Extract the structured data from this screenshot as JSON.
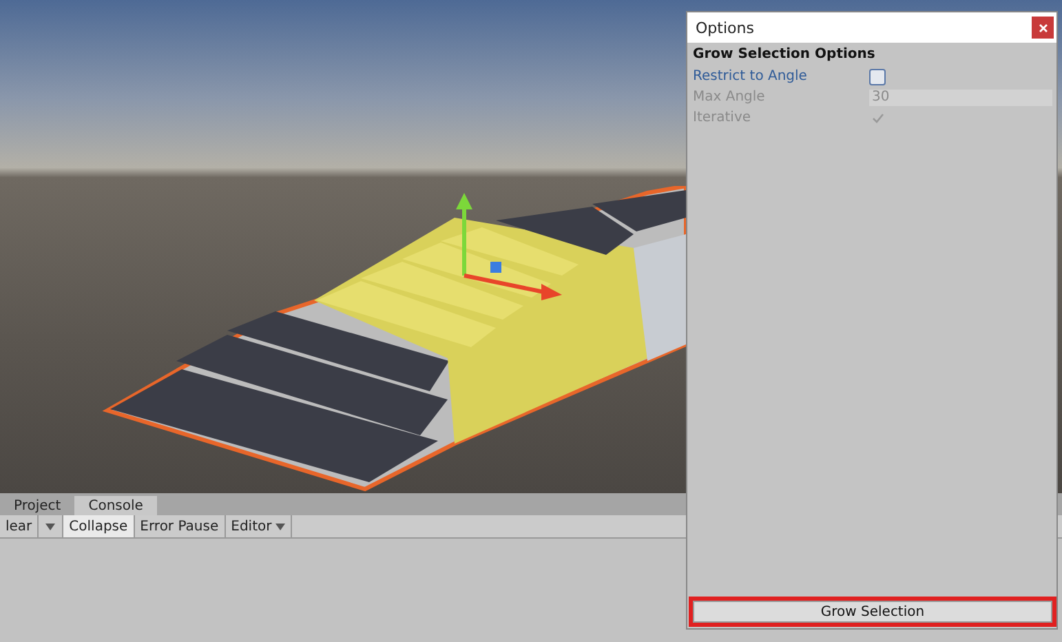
{
  "bottom_panel": {
    "tabs": [
      {
        "label": "Project",
        "selected": false
      },
      {
        "label": "Console",
        "selected": true
      }
    ],
    "toolbar": [
      {
        "kind": "button",
        "label": "lear",
        "selected": false
      },
      {
        "kind": "caret"
      },
      {
        "kind": "toggle",
        "label": "Collapse",
        "selected": true
      },
      {
        "kind": "toggle",
        "label": "Error Pause",
        "selected": false
      },
      {
        "kind": "menu",
        "label": "Editor"
      }
    ]
  },
  "options_window": {
    "title": "Options",
    "heading": "Grow Selection Options",
    "fields": [
      {
        "kind": "checkbox",
        "label": "Restrict to Angle",
        "checked": false,
        "disabled": false
      },
      {
        "kind": "number",
        "label": "Max Angle",
        "value": "30",
        "disabled": true
      },
      {
        "kind": "checkbox",
        "label": "Iterative",
        "checked": true,
        "disabled": true
      }
    ],
    "button": {
      "label": "Grow Selection",
      "highlighted": true
    }
  }
}
